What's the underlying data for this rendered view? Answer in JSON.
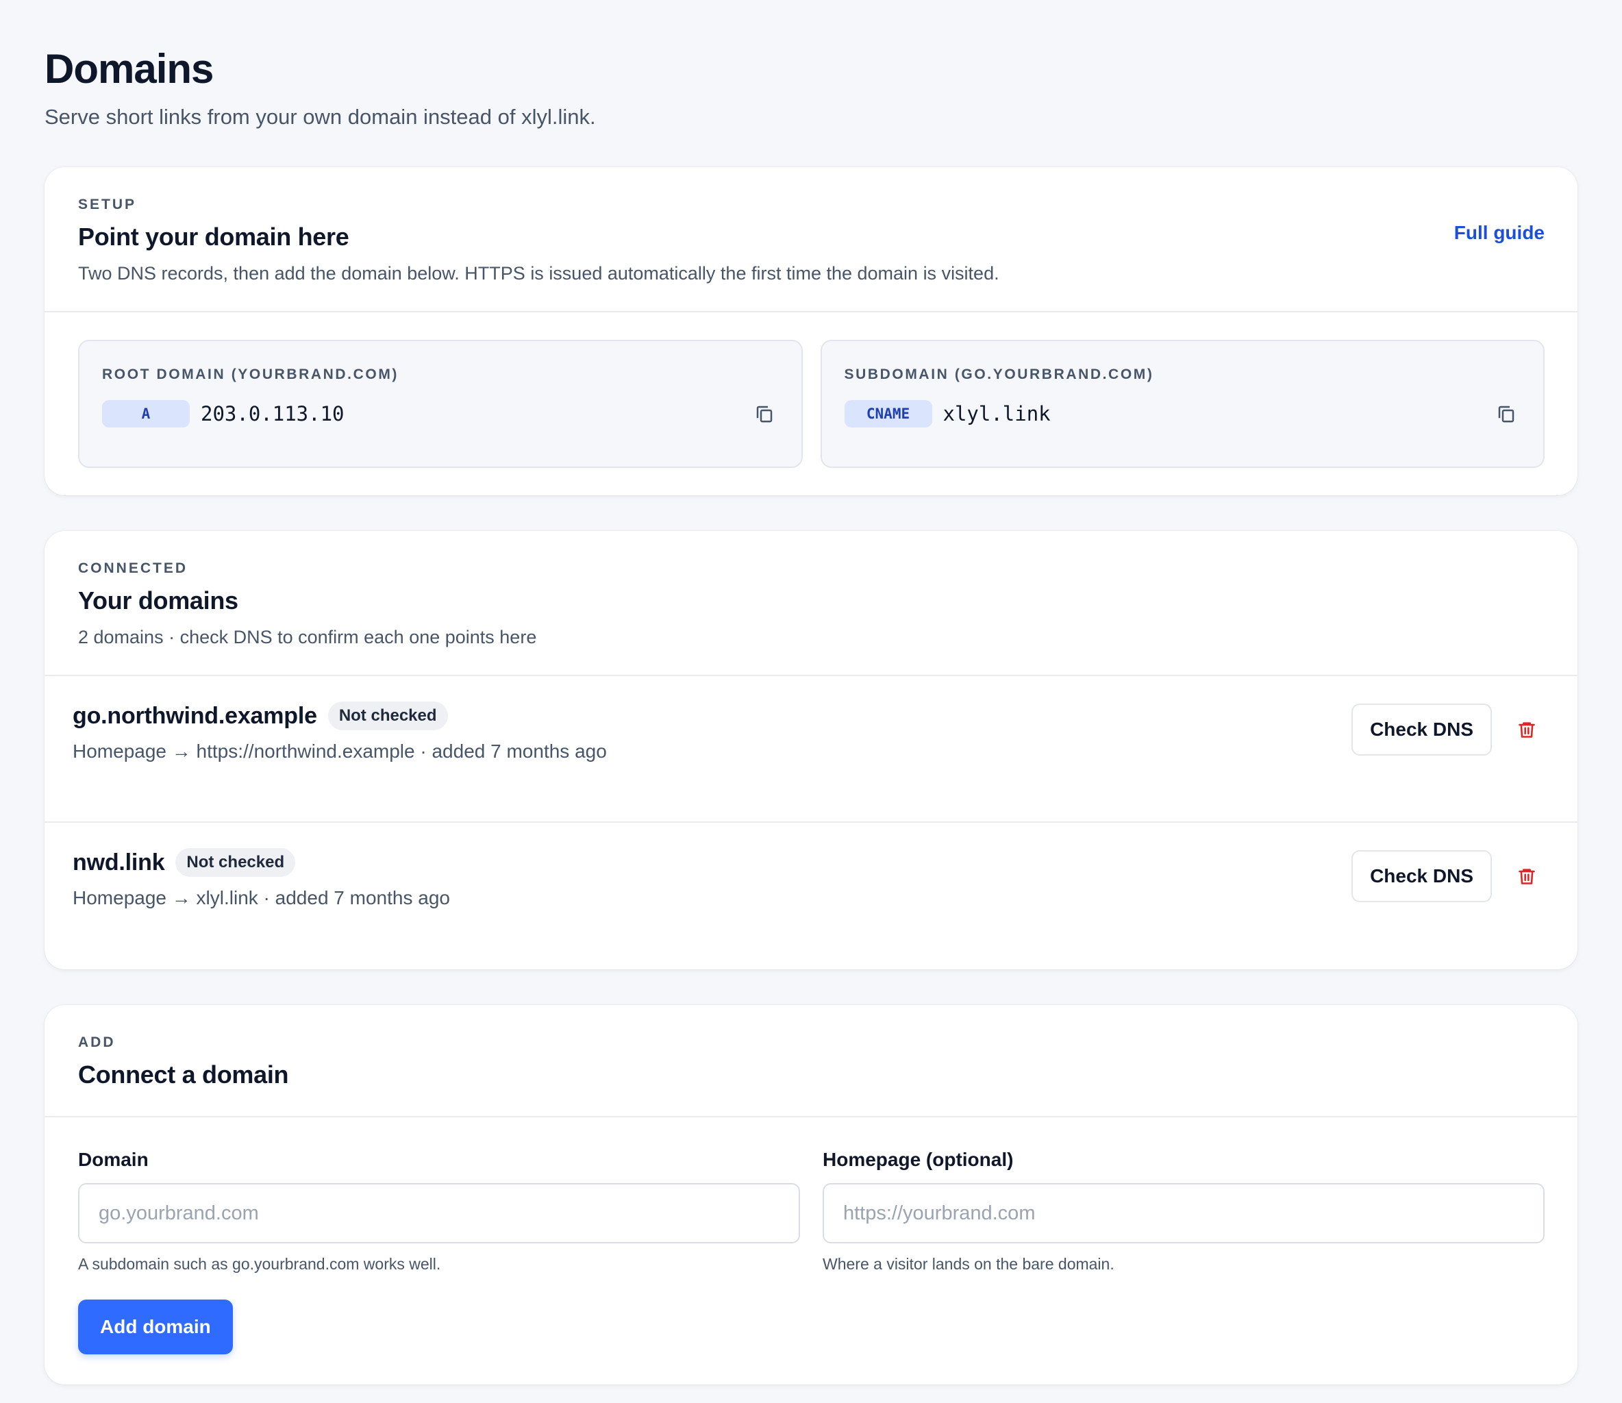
{
  "header": {
    "title": "Domains",
    "subtitle": "Serve short links from your own domain instead of xlyl.link."
  },
  "setup": {
    "eyebrow": "SETUP",
    "title": "Point your domain here",
    "description": "Two DNS records, then add the domain below. HTTPS is issued automatically the first time the domain is visited.",
    "guide_link": "Full guide",
    "records": [
      {
        "label": "ROOT DOMAIN (YOURBRAND.COM)",
        "type": "A",
        "value": "203.0.113.10",
        "icon": "copy-icon"
      },
      {
        "label": "SUBDOMAIN (GO.YOURBRAND.COM)",
        "type": "CNAME",
        "value": "xlyl.link",
        "icon": "copy-icon"
      }
    ]
  },
  "connected": {
    "eyebrow": "CONNECTED",
    "title": "Your domains",
    "description": "2 domains · check DNS to confirm each one points here",
    "domains": [
      {
        "name": "go.northwind.example",
        "status": "Not checked",
        "meta": "Homepage → https://northwind.example · added 7 months ago",
        "action": "Check DNS"
      },
      {
        "name": "nwd.link",
        "status": "Not checked",
        "meta": "Homepage → xlyl.link · added 7 months ago",
        "action": "Check DNS"
      }
    ]
  },
  "add": {
    "eyebrow": "ADD",
    "title": "Connect a domain",
    "domain_field": {
      "label": "Domain",
      "placeholder": "go.yourbrand.com",
      "value": "",
      "hint": "A subdomain such as go.yourbrand.com works well."
    },
    "homepage_field": {
      "label": "Homepage (optional)",
      "placeholder": "https://yourbrand.com",
      "value": "",
      "hint": "Where a visitor lands on the bare domain."
    },
    "submit_label": "Add domain"
  },
  "colors": {
    "accent": "#2f6bff",
    "link": "#1d4ed8",
    "danger": "#dc2626",
    "record_badge_bg": "#dbe4fd"
  }
}
